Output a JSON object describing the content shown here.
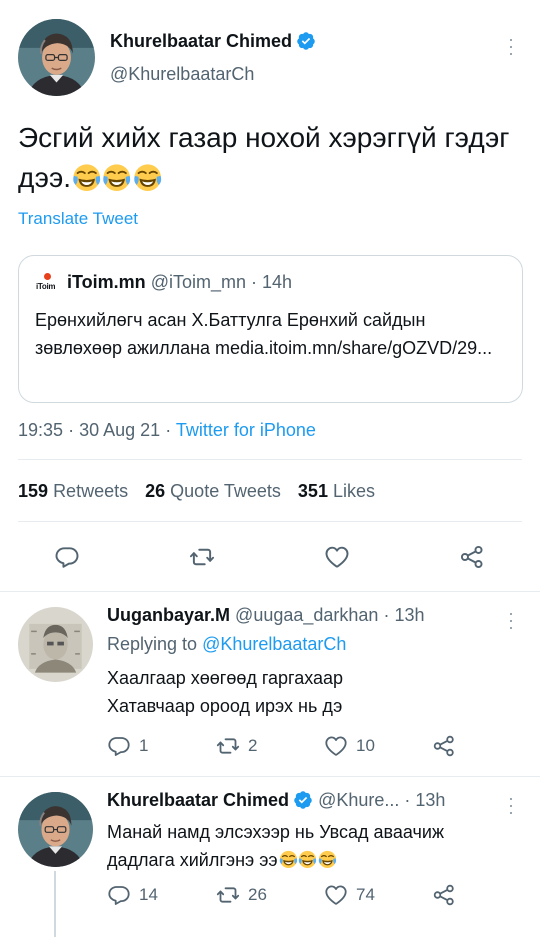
{
  "main_tweet": {
    "author_name": "Khurelbaatar Chimed",
    "author_handle": "@KhurelbaatarCh",
    "text": "Эсгий хийх газар нохой хэрэггүй гэдэг дээ.",
    "emoji": "😂😂😂",
    "translate": "Translate Tweet",
    "time": "19:35",
    "date": "30 Aug 21",
    "source": "Twitter for iPhone",
    "sep": "·"
  },
  "quoted": {
    "logo_text": "iToim",
    "name": "iToim.mn",
    "handle": "@iToim_mn",
    "age": "14h",
    "text": "Ерөнхийлөгч асан Х.Баттулга Ерөнхий сайдын зөвлөхөөр ажиллана media.itoim.mn/share/gOZVD/29..."
  },
  "stats": {
    "retweets_count": "159",
    "retweets_label": "Retweets",
    "quotes_count": "26",
    "quotes_label": "Quote Tweets",
    "likes_count": "351",
    "likes_label": "Likes"
  },
  "actions": [
    "reply-icon",
    "retweet-icon",
    "like-icon",
    "share-icon"
  ],
  "replies": [
    {
      "author_name": "Uuganbayar.M",
      "author_handle": "@uugaa_darkhan",
      "age": "13h",
      "replying_to_label": "Replying to",
      "replying_to_handle": "@KhurelbaatarCh",
      "text_line1": "Хаалгаар хөөгөөд гаргахаар",
      "text_line2": "Хатавчаар ороод ирэх нь дэ",
      "reply_count": "1",
      "retweet_count": "2",
      "like_count": "10"
    },
    {
      "author_name": "Khurelbaatar Chimed",
      "author_handle": "@Khure...",
      "age": "13h",
      "text_line1": "Манай намд элсэхээр нь Увсад аваачиж",
      "text_line2": "дадлага хийлгэнэ ээ",
      "emoji": "😂😂😂",
      "reply_count": "14",
      "retweet_count": "26",
      "like_count": "74"
    }
  ],
  "colors": {
    "accent": "#1d9bf0",
    "text": "#0f1419",
    "muted": "#536471",
    "divider": "#e6ecf0",
    "logo_red": "#e8401c"
  }
}
